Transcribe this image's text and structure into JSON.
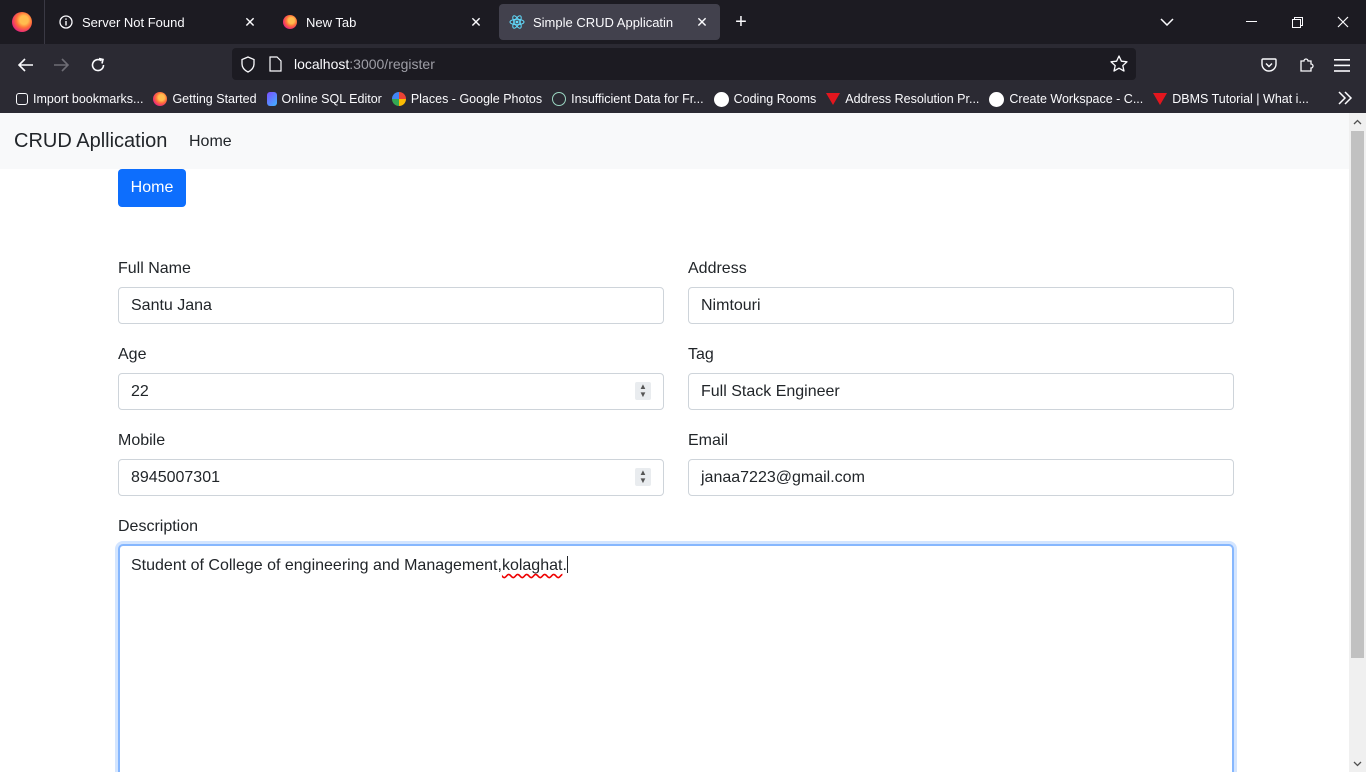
{
  "browser": {
    "tabs": [
      {
        "title": "Server Not Found",
        "icon": "info-icon"
      },
      {
        "title": "New Tab",
        "icon": "firefox-icon"
      },
      {
        "title": "Simple CRUD Applicatin",
        "icon": "react-icon",
        "active": true
      }
    ],
    "url": {
      "host": "localhost",
      "path": ":3000/register"
    },
    "bookmarks": [
      {
        "label": "Import bookmarks...",
        "icon": "import-icon"
      },
      {
        "label": "Getting Started",
        "icon": "firefox-icon"
      },
      {
        "label": "Online SQL Editor",
        "icon": "sql-editor-icon"
      },
      {
        "label": "Places - Google Photos",
        "icon": "google-photos-icon"
      },
      {
        "label": "Insufficient Data for Fr...",
        "icon": "openai-icon"
      },
      {
        "label": "Coding Rooms",
        "icon": "coding-rooms-icon"
      },
      {
        "label": "Address Resolution Pr...",
        "icon": "tutorial-v-icon"
      },
      {
        "label": "Create Workspace - C...",
        "icon": "workspace-icon"
      },
      {
        "label": "DBMS Tutorial | What i...",
        "icon": "tutorial-v-icon"
      }
    ]
  },
  "app": {
    "brand": "CRUD Apllication",
    "nav_home": "Home",
    "home_button": "Home"
  },
  "form": {
    "full_name": {
      "label": "Full Name",
      "value": "Santu Jana"
    },
    "address": {
      "label": "Address",
      "value": "Nimtouri"
    },
    "age": {
      "label": "Age",
      "value": "22"
    },
    "tag": {
      "label": "Tag",
      "value": "Full Stack Engineer"
    },
    "mobile": {
      "label": "Mobile",
      "value": "8945007301"
    },
    "email": {
      "label": "Email",
      "value": "janaa7223@gmail.com"
    },
    "description": {
      "label": "Description",
      "value_main": "Student of College of engineering and Management,",
      "value_misspelled": "kolaghat",
      "value_end": "."
    }
  },
  "colors": {
    "primary": "#0d6efd",
    "browser_bg": "#1c1b22",
    "toolbar_bg": "#2b2a33",
    "active_tab": "#42414d"
  }
}
